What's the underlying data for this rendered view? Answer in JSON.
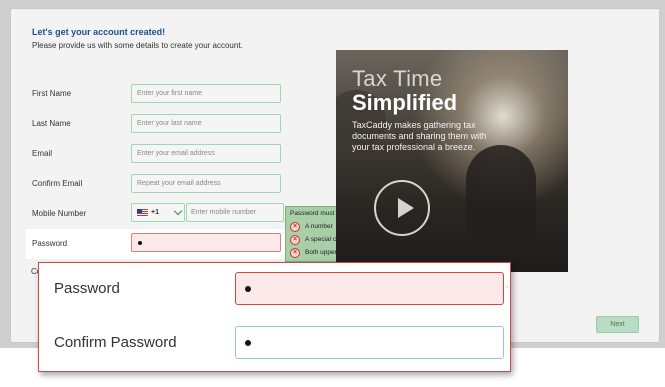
{
  "form": {
    "heading": "Let's get your account created!",
    "subheading": "Please provide us with some details to create your account.",
    "fields": {
      "first_name": {
        "label": "First Name",
        "placeholder": "Enter your first name"
      },
      "last_name": {
        "label": "Last Name",
        "placeholder": "Enter your last name"
      },
      "email": {
        "label": "Email",
        "placeholder": "Enter your email address"
      },
      "confirm_email": {
        "label": "Confirm Email",
        "placeholder": "Repeat your email address"
      },
      "mobile": {
        "label": "Mobile Number",
        "country_code": "+1",
        "flag_icon": "us-flag-icon",
        "placeholder": "Enter mobile number"
      },
      "password": {
        "label": "Password",
        "value_masked": "•"
      }
    },
    "cut_off_label": "Co",
    "next_label": "Next"
  },
  "password_requirements": {
    "title": "Password must have the following:",
    "items": [
      {
        "text": "A number",
        "icon": "x-circle-icon",
        "status_color": "#c0392b"
      },
      {
        "text": "A special character (spaces not permitted)",
        "icon": "x-circle-icon",
        "status_color": "#c0392b"
      },
      {
        "text": "Both upper case and lower case letters",
        "icon": "x-circle-icon",
        "status_color": "#c0392b"
      }
    ]
  },
  "promo": {
    "title_line1": "Tax Time",
    "title_line2": "Simplified",
    "description": "TaxCaddy makes gathering tax documents and sharing them with your tax professional a breeze.",
    "play_icon": "play-icon"
  },
  "zoom": {
    "password_label": "Password",
    "confirm_label": "Confirm Password"
  },
  "colors": {
    "accent_green": "#9fd6b4",
    "error_red": "#d64545",
    "heading_blue": "#1d4f8c"
  }
}
